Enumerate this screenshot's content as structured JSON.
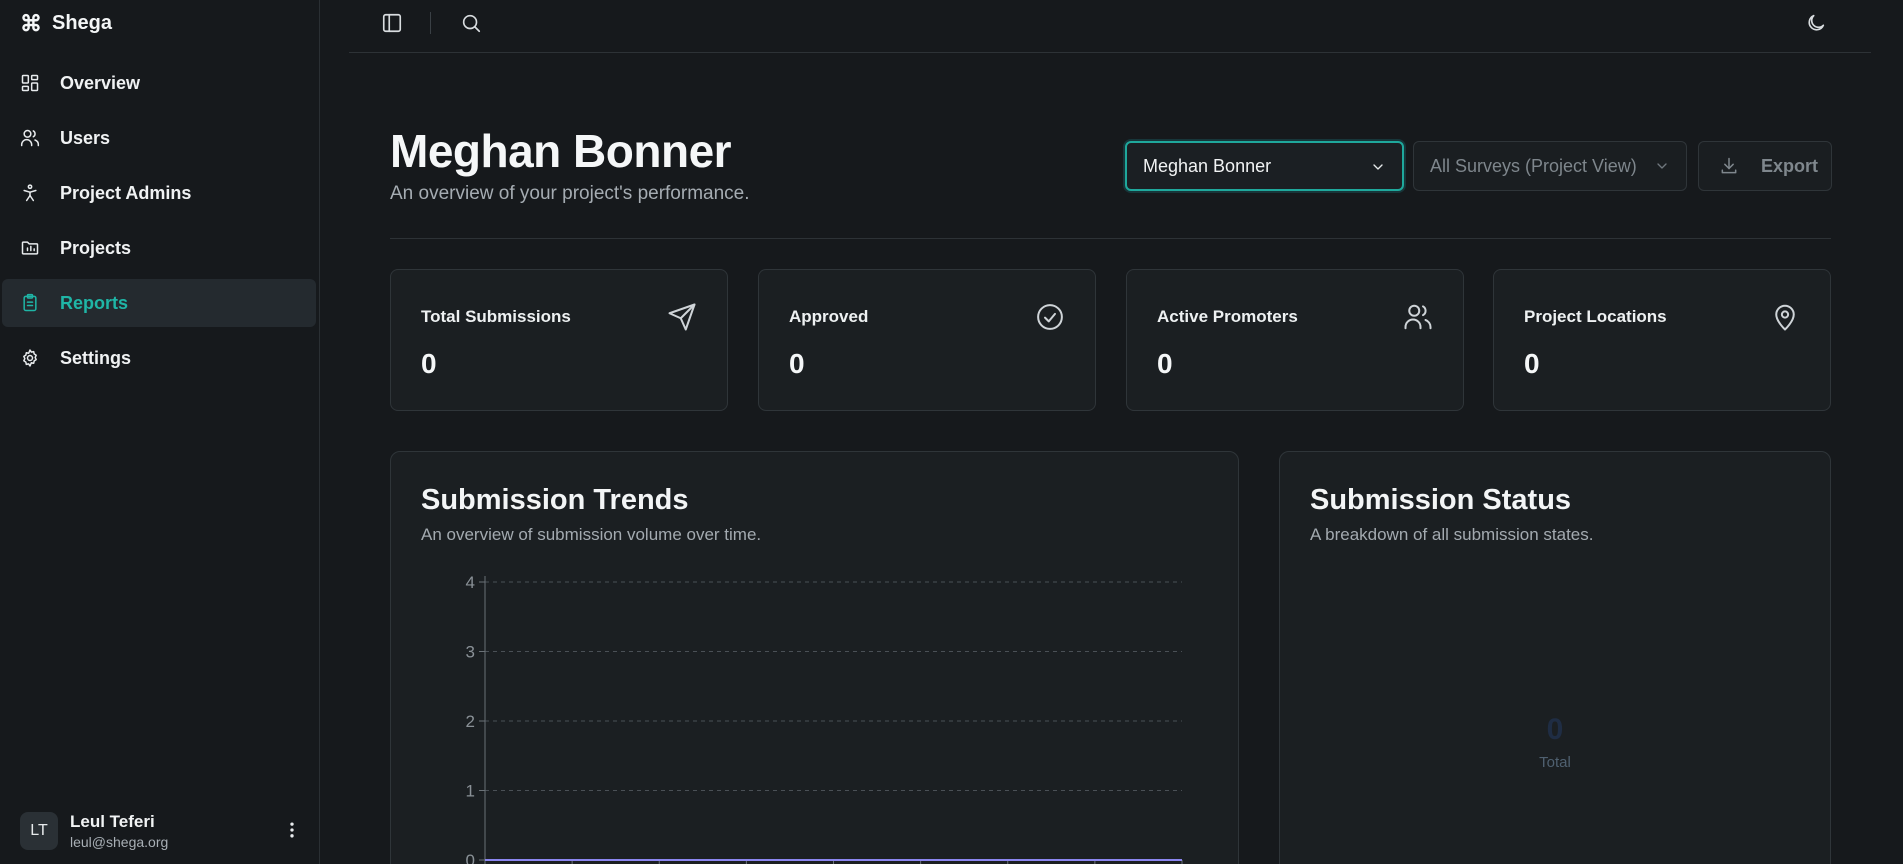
{
  "brand": {
    "name": "Shega",
    "icon": "command-icon"
  },
  "sidebar": {
    "items": [
      {
        "label": "Overview",
        "icon": "grid-icon"
      },
      {
        "label": "Users",
        "icon": "users-icon"
      },
      {
        "label": "Project Admins",
        "icon": "person-icon"
      },
      {
        "label": "Projects",
        "icon": "folder-icon"
      },
      {
        "label": "Reports",
        "icon": "clipboard-icon",
        "active": true
      },
      {
        "label": "Settings",
        "icon": "gear-icon"
      }
    ]
  },
  "user": {
    "initials": "LT",
    "name": "Leul Teferi",
    "email": "leul@shega.org"
  },
  "header": {
    "title": "Meghan Bonner",
    "subtitle": "An overview of your project's performance.",
    "promoter_select": "Meghan Bonner",
    "survey_select": "All Surveys (Project View)",
    "export_label": "Export"
  },
  "stats": [
    {
      "label": "Total Submissions",
      "value": "0",
      "icon": "send-icon"
    },
    {
      "label": "Approved",
      "value": "0",
      "icon": "check-circle-icon"
    },
    {
      "label": "Active Promoters",
      "value": "0",
      "icon": "users-icon"
    },
    {
      "label": "Project Locations",
      "value": "0",
      "icon": "map-pin-icon"
    }
  ],
  "trends": {
    "title": "Submission Trends",
    "subtitle": "An overview of submission volume over time."
  },
  "status": {
    "title": "Submission Status",
    "subtitle": "A breakdown of all submission states.",
    "total_value": "0",
    "total_label": "Total"
  },
  "colors": {
    "accent": "#1fb5a6",
    "line": "#8b86f0",
    "background": "#16191c",
    "card": "#1b1f22"
  },
  "chart_data": {
    "type": "line",
    "title": "Submission Trends",
    "yticks": [
      0,
      1,
      2,
      3,
      4
    ],
    "ylim": [
      0,
      4
    ],
    "grid": true,
    "series": [
      {
        "values": [
          0,
          0,
          0,
          0,
          0,
          0,
          0,
          0
        ]
      }
    ]
  }
}
